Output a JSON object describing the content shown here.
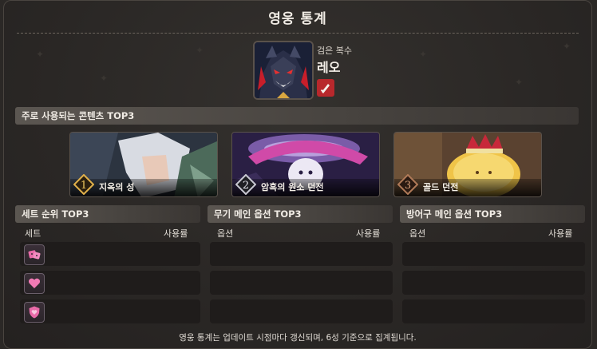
{
  "title": "영웅 통계",
  "hero": {
    "subtitle": "검은 복수",
    "name": "레오",
    "class_icon": "knight-sword-icon",
    "class_color": "#b8282c"
  },
  "contents_section": {
    "label": "주로 사용되는 콘텐츠 TOP3",
    "cards": [
      {
        "rank": "1",
        "name": "지옥의 성"
      },
      {
        "rank": "2",
        "name": "암흑의 원소 던전"
      },
      {
        "rank": "3",
        "name": "골드 던전"
      }
    ]
  },
  "set_section": {
    "label": "세트 순위 TOP3",
    "col_left": "세트",
    "col_right": "사용률",
    "rows": [
      {
        "icon": "dice-set-icon"
      },
      {
        "icon": "heart-set-icon"
      },
      {
        "icon": "shield-heart-set-icon"
      }
    ]
  },
  "weapon_section": {
    "label": "무기 메인 옵션 TOP3",
    "col_left": "옵션",
    "col_right": "사용률"
  },
  "armor_section": {
    "label": "방어구 메인 옵션 TOP3",
    "col_left": "옵션",
    "col_right": "사용률"
  },
  "footer": "영웅 통계는 업데이트 시점마다 갱신되며, 6성 기준으로 집계됩니다.",
  "colors": {
    "background": "#2b2826",
    "row": "#1f1c1b",
    "accent_pink": "#e86aa8"
  }
}
